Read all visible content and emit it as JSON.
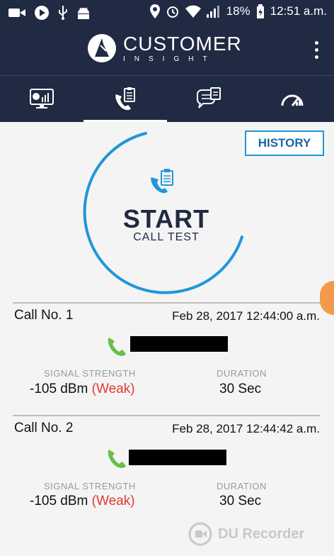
{
  "status_bar": {
    "battery": "18%",
    "time": "12:51 a.m."
  },
  "app": {
    "logo_name": "CUSTOMER",
    "logo_sub": "INSIGHT"
  },
  "tabs": [
    {
      "icon": "monitor-chart-icon",
      "active": false
    },
    {
      "icon": "phone-clipboard-icon",
      "active": true
    },
    {
      "icon": "chat-clipboard-icon",
      "active": false
    },
    {
      "icon": "speedometer-icon",
      "active": false
    }
  ],
  "history_button": "HISTORY",
  "start": {
    "title": "START",
    "subtitle": "CALL TEST"
  },
  "calls": [
    {
      "title": "Call No. 1",
      "date": "Feb 28, 2017 12:44:00 a.m.",
      "signal_label": "SIGNAL STRENGTH",
      "signal_value": "-105 dBm",
      "signal_quality": "(Weak)",
      "duration_label": "DURATION",
      "duration_value": "30 Sec"
    },
    {
      "title": "Call No. 2",
      "date": "Feb 28, 2017 12:44:42 a.m.",
      "signal_label": "SIGNAL STRENGTH",
      "signal_value": "-105 dBm",
      "signal_quality": "(Weak)",
      "duration_label": "DURATION",
      "duration_value": "30 Sec"
    }
  ],
  "watermark": "DU Recorder",
  "colors": {
    "header_bg": "#212a43",
    "accent_blue": "#2196d8",
    "weak_red": "#e03a2e",
    "call_green": "#6abf4b"
  }
}
